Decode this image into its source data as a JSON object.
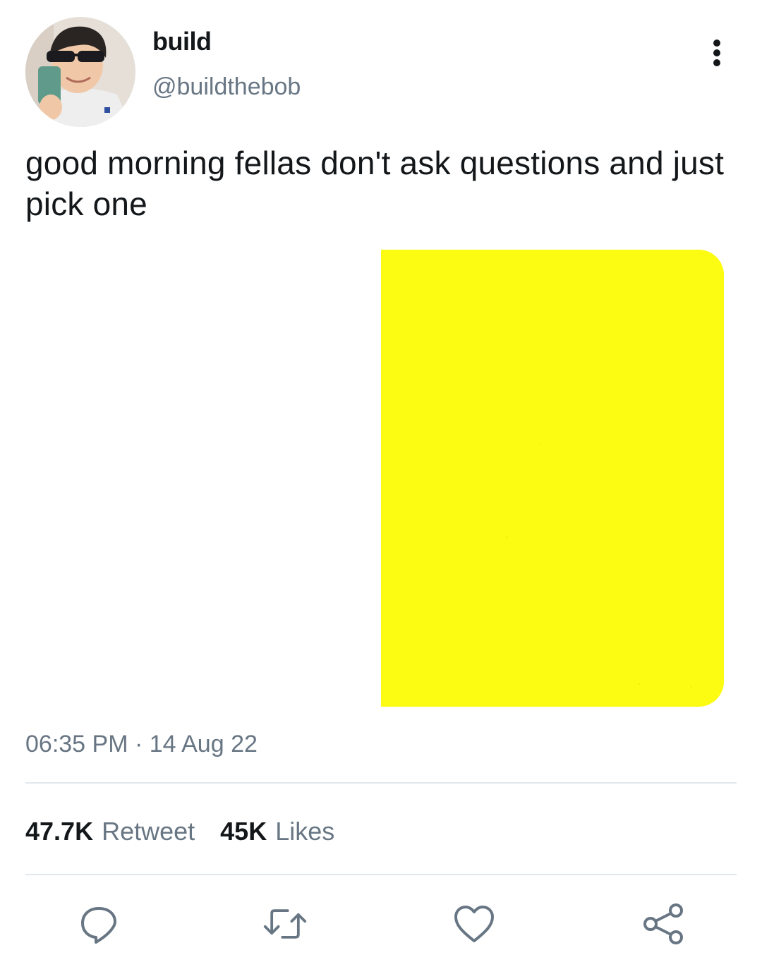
{
  "author": {
    "display_name": "build",
    "handle": "@buildthebob"
  },
  "tweet": {
    "text": "good morning fellas don't ask questions and just pick one",
    "media_color": "#fcfc12",
    "timestamp": "06:35 PM · 14 Aug 22"
  },
  "stats": {
    "retweet_count": "47.7K",
    "retweet_label": "Retweet",
    "like_count": "45K",
    "like_label": "Likes"
  },
  "actions": [
    "reply-icon",
    "retweet-icon",
    "like-icon",
    "share-icon"
  ],
  "colors": {
    "text": "#14171a",
    "secondary": "#687684",
    "divider": "#e1e8ed",
    "icon": "#687684"
  }
}
